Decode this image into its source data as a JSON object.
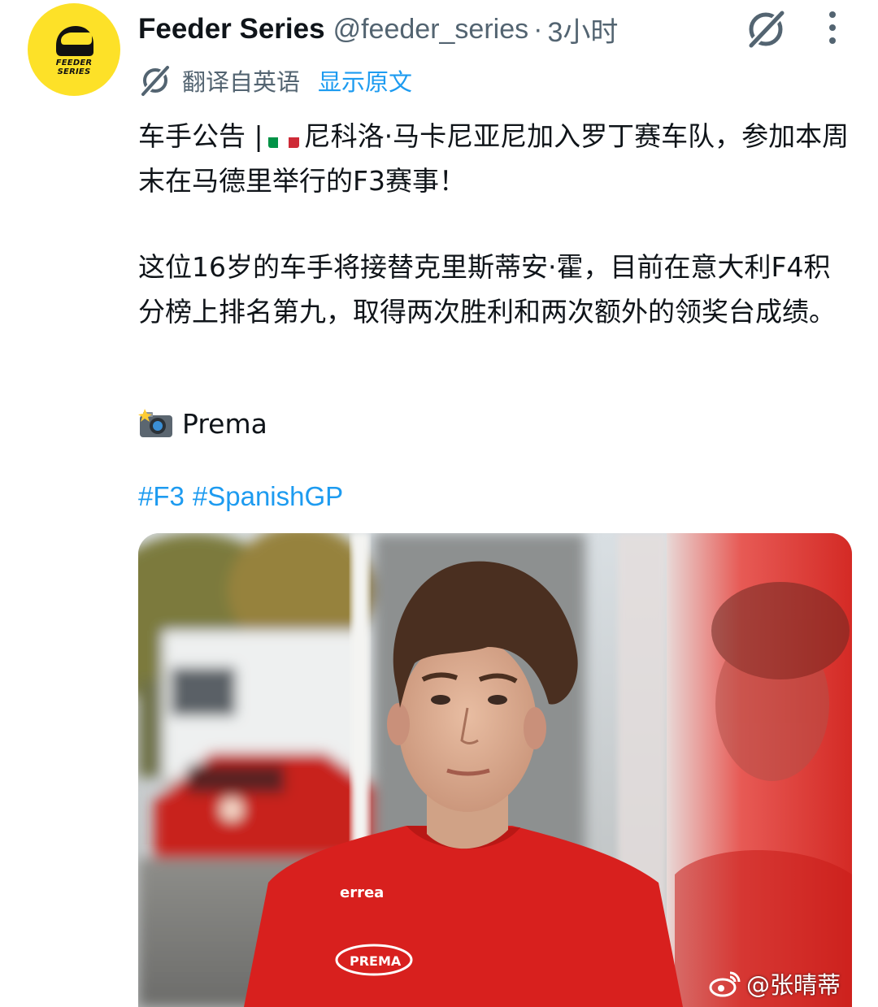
{
  "post": {
    "author_name": "Feeder Series",
    "handle": "@feeder_series",
    "separator": "·",
    "time": "3小时",
    "avatar_text_line1": "FEEDER",
    "avatar_text_line2": "SERIES",
    "translated_label": "翻译自英语",
    "show_original": "显示原文",
    "body": {
      "line1_before_flag": "车手公告 |",
      "line1_after_flag": "尼科洛·马卡尼亚尼加入罗丁赛车队，参加本周末在马德里举行的F3赛事！",
      "paragraph2": "这位16岁的车手将接替克里斯蒂安·霍，目前在意大利F4积分榜上排名第九，取得两次胜利和两次额外的领奖台成绩。"
    },
    "photo_credit": "Prema",
    "hashtags": [
      "#F3",
      "#SpanishGP"
    ],
    "media": {
      "shirt_brand": "errea",
      "shirt_logo": "PREMA"
    }
  },
  "watermark": {
    "text": "@张晴蒂"
  },
  "colors": {
    "accent": "#1d9bf0",
    "secondary_text": "#536471",
    "primary_text": "#0f1419",
    "avatar_bg": "#fde128",
    "shirt_red": "#d8201e"
  },
  "icons": {
    "grok": "grok-icon",
    "more": "more-vertical-icon",
    "translate": "grok-translate-icon",
    "camera": "camera-flash-icon",
    "weibo": "weibo-icon",
    "flag": "italy-flag-icon"
  }
}
